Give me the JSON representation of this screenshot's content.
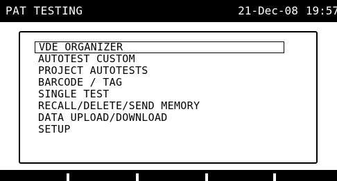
{
  "header": {
    "title": "PAT TESTING",
    "date": "21-Dec-08",
    "time": "19:57"
  },
  "menu": {
    "selected_index": 0,
    "items": [
      {
        "label": "VDE ORGANIZER"
      },
      {
        "label": "AUTOTEST CUSTOM"
      },
      {
        "label": "PROJECT AUTOTESTS"
      },
      {
        "label": "BARCODE / TAG"
      },
      {
        "label": "SINGLE TEST"
      },
      {
        "label": "RECALL/DELETE/SEND MEMORY"
      },
      {
        "label": "DATA UPLOAD/DOWNLOAD"
      },
      {
        "label": "SETUP"
      }
    ]
  },
  "softkeys": {
    "count": 5
  },
  "colors": {
    "background": "#ffffff",
    "foreground": "#000000"
  }
}
